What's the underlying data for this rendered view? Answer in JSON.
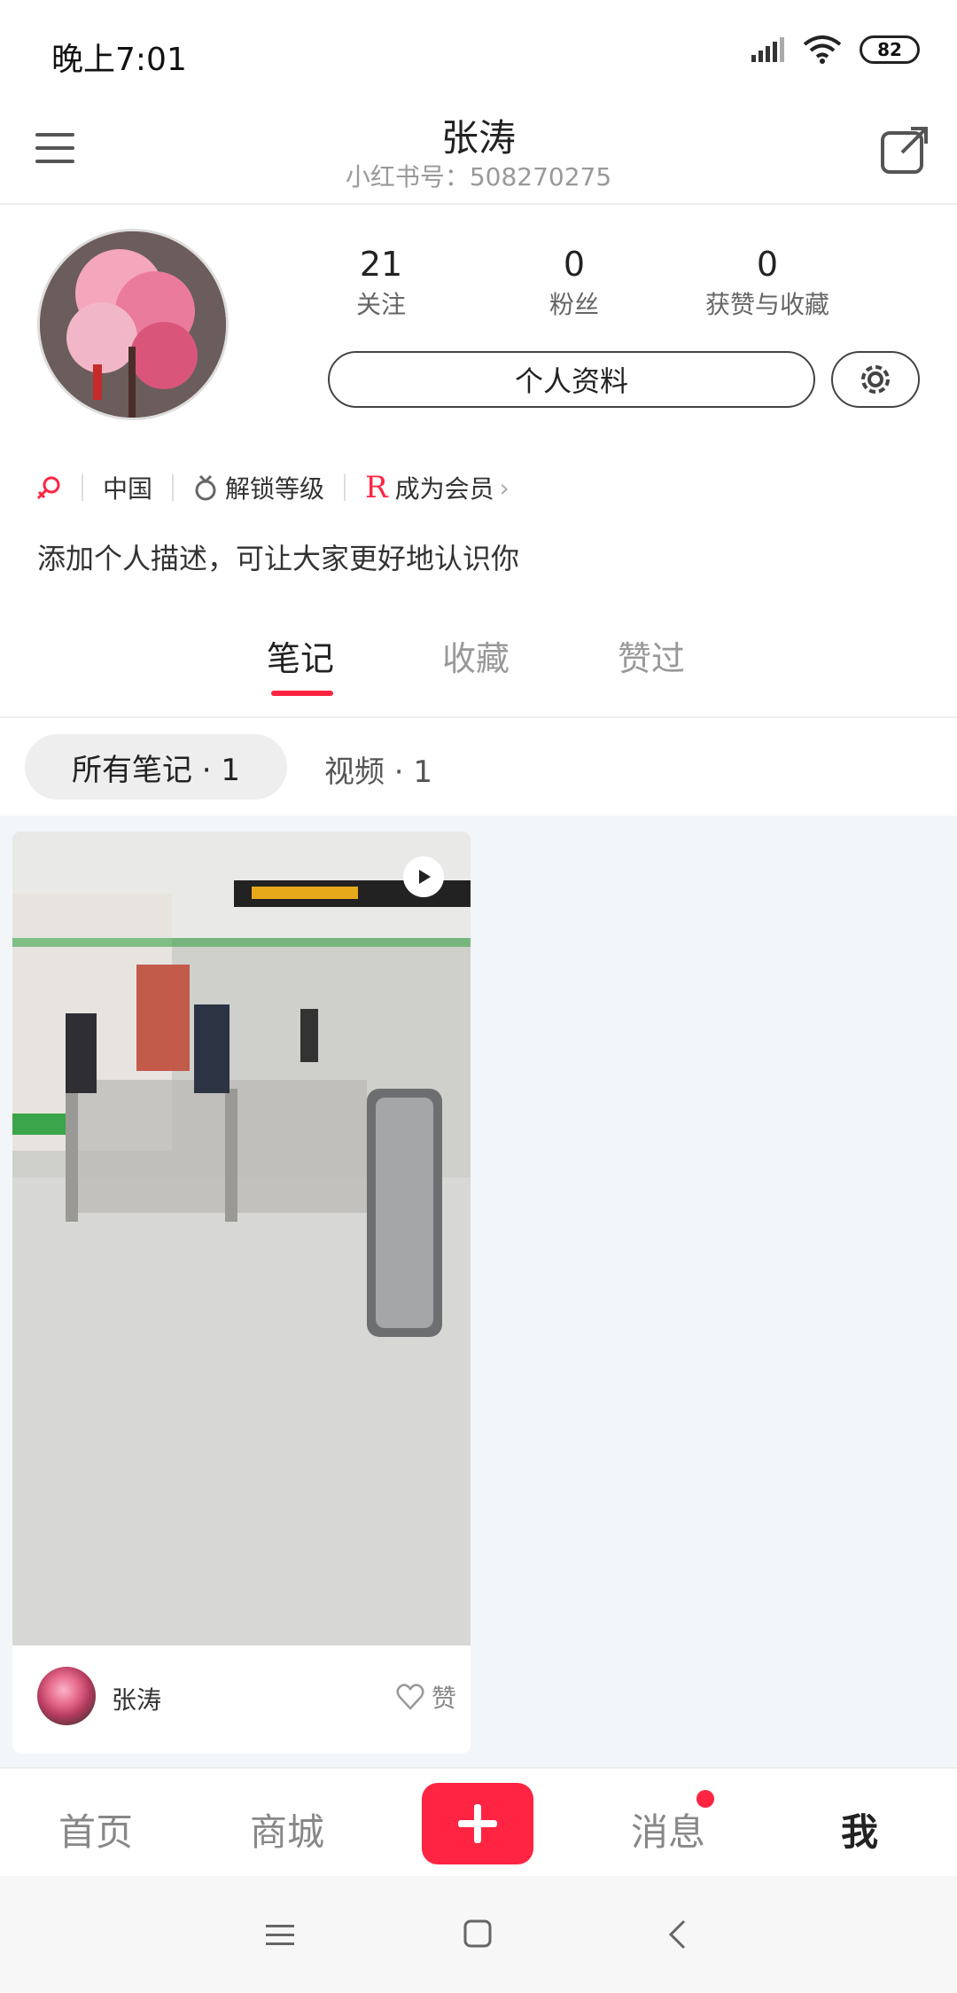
{
  "status_bar": {
    "time": "晚上7:01",
    "battery": "82"
  },
  "header": {
    "name": "张涛",
    "id_text": "小红书号：508270275"
  },
  "stats": [
    {
      "value": "21",
      "label": "关注"
    },
    {
      "value": "0",
      "label": "粉丝"
    },
    {
      "value": "0",
      "label": "获赞与收藏"
    }
  ],
  "buttons": {
    "profile": "个人资料"
  },
  "tags": {
    "location": "中国",
    "level": "解锁等级",
    "vip": "成为会员"
  },
  "bio": "添加个人描述，可让大家更好地认识你",
  "tabs": [
    "笔记",
    "收藏",
    "赞过"
  ],
  "filters": {
    "all": "所有笔记 · 1",
    "video": "视频 · 1"
  },
  "note": {
    "author": "张涛",
    "like_label": "赞"
  },
  "bottom_nav": [
    "首页",
    "商城",
    "消息",
    "我"
  ],
  "colors": {
    "accent": "#ff2442"
  }
}
